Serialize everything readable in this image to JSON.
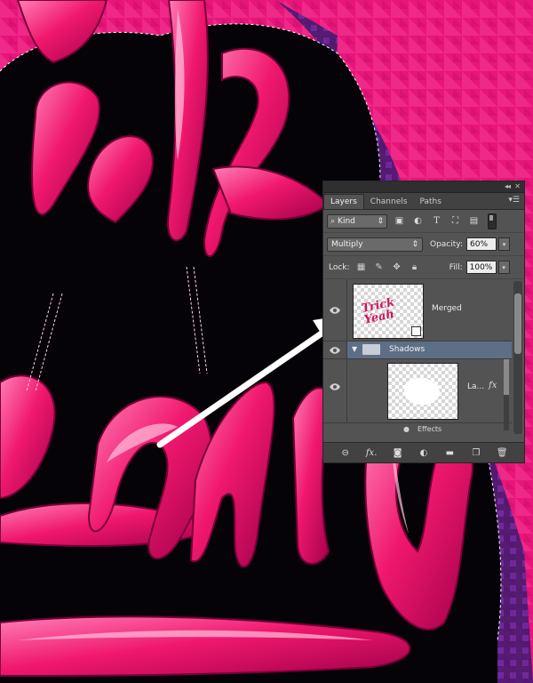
{
  "panel": {
    "tabs": [
      "Layers",
      "Channels",
      "Paths"
    ],
    "active_tab": "Layers",
    "filter": {
      "kind_label": "Kind",
      "icons": [
        "image-filter-icon",
        "adjustment-filter-icon",
        "type-filter-icon",
        "shape-filter-icon",
        "smart-object-filter-icon"
      ]
    },
    "blend_mode": "Multiply",
    "opacity_label": "Opacity:",
    "opacity_value": "60%",
    "lock_label": "Lock:",
    "fill_label": "Fill:",
    "fill_value": "100%",
    "layers": [
      {
        "name": "Merged",
        "type": "smart-object",
        "visible": true,
        "selected": false
      },
      {
        "name": "Shadows",
        "type": "group",
        "visible": true,
        "selected": true
      },
      {
        "name": "La...",
        "type": "layer",
        "visible": true,
        "selected": false,
        "has_fx": true,
        "fx_label": "fx"
      }
    ],
    "effects_label": "Effects",
    "bottom_icons": [
      "link-icon",
      "fx-icon",
      "mask-icon",
      "adjustment-icon",
      "folder-icon",
      "new-layer-icon",
      "trash-icon"
    ],
    "fx_button_label": "fx."
  },
  "thumbnail_text": "Trick Yeah",
  "colors": {
    "background_pink": "#e8157a",
    "panel_bg": "#535353",
    "selected_row": "#5d6f86",
    "lettering_pink": "#f0186e",
    "shadow_black": "#000000"
  }
}
